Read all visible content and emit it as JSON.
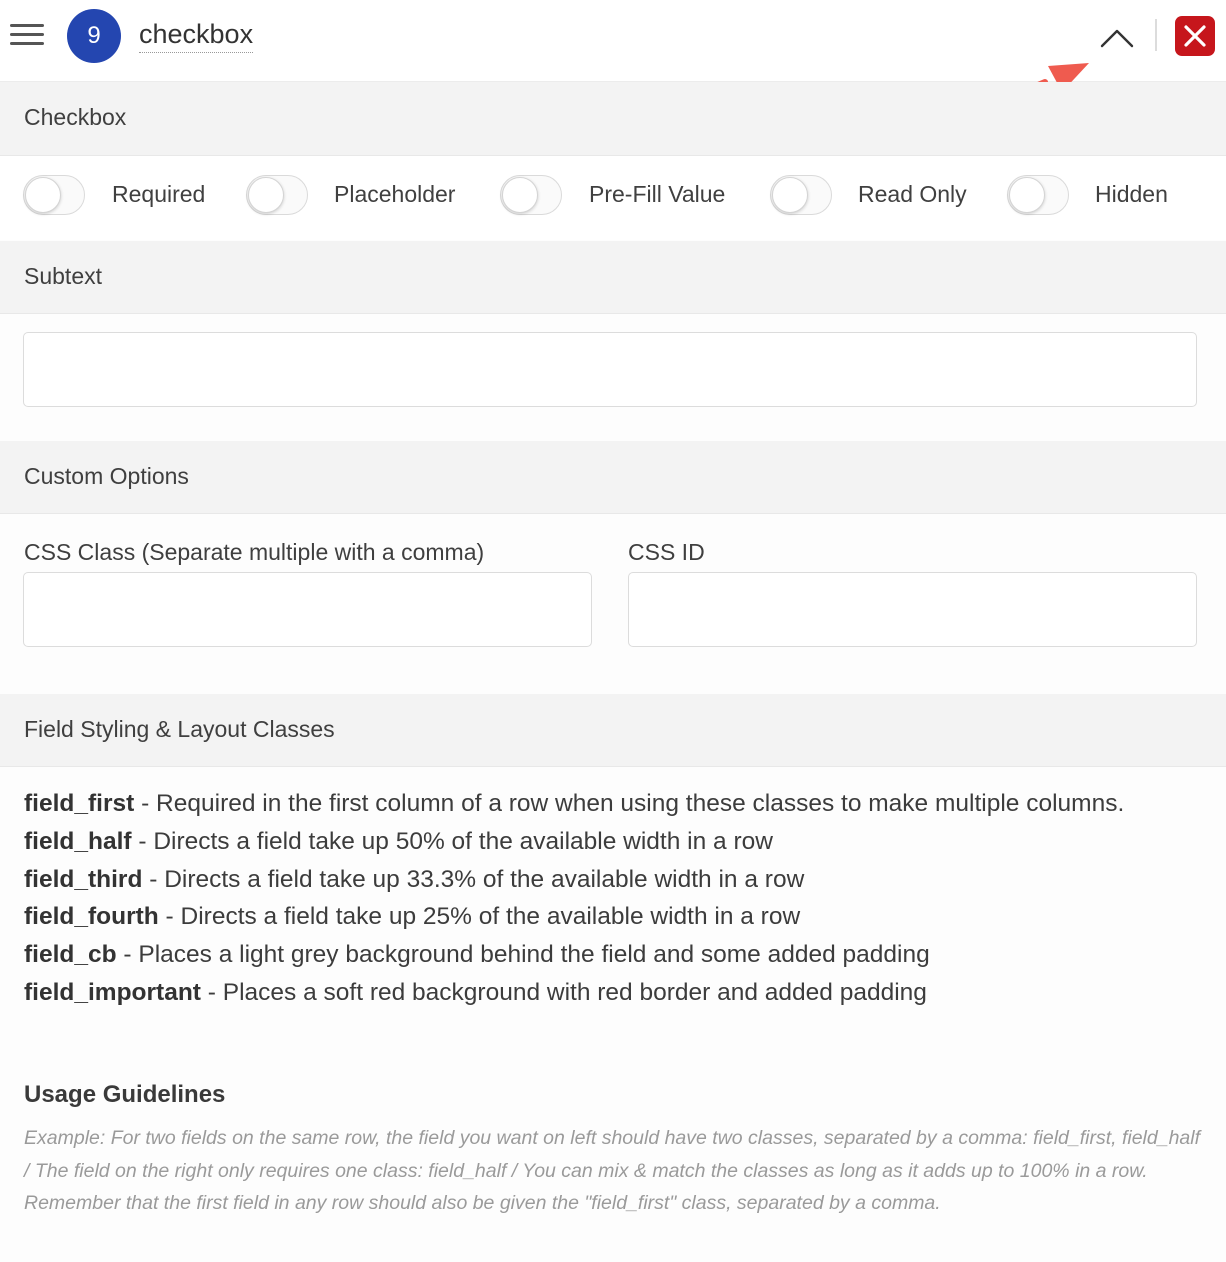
{
  "header": {
    "field_number": "9",
    "field_title": "checkbox",
    "icons": {
      "menu": "hamburger-menu-icon",
      "collapse": "chevron-up-icon",
      "close": "close-x-icon"
    },
    "colors": {
      "badge": "#2446b0",
      "close": "#c6161c",
      "annotation_arrow": "#ef5b4f"
    }
  },
  "sections": {
    "checkbox": "Checkbox",
    "subtext": "Subtext",
    "custom_options": "Custom Options",
    "styling": "Field Styling & Layout Classes"
  },
  "toggles": [
    {
      "label": "Required",
      "on": false
    },
    {
      "label": "Placeholder",
      "on": false
    },
    {
      "label": "Pre-Fill Value",
      "on": false
    },
    {
      "label": "Read Only",
      "on": false
    },
    {
      "label": "Hidden",
      "on": false
    }
  ],
  "subtext_input": {
    "value": "",
    "placeholder": ""
  },
  "custom_options": {
    "css_class_label": "CSS Class (Separate multiple with a comma)",
    "css_class_value": "",
    "css_id_label": "CSS ID",
    "css_id_value": ""
  },
  "styling_classes": [
    {
      "name": "field_first",
      "desc": " - Required in the first column of a row when using these classes to make multiple columns."
    },
    {
      "name": "field_half",
      "desc": " - Directs a field take up 50% of the available width in a row"
    },
    {
      "name": "field_third",
      "desc": " - Directs a field take up 33.3% of the available width in a row"
    },
    {
      "name": "field_fourth",
      "desc": " - Directs a field take up 25% of the available width in a row"
    },
    {
      "name": "field_cb",
      "desc": " - Places a light grey background behind the field and some added padding"
    },
    {
      "name": "field_important",
      "desc": " - Places a soft red background with red border and added padding"
    }
  ],
  "usage": {
    "title": "Usage Guidelines",
    "text": "Example: For two fields on the same row, the field you want on left should have two classes, separated by a comma: field_first, field_half / The field on the right only requires one class: field_half / You can mix & match the classes as long as it adds up to 100% in a row. Remember that the first field in any row should also be given the \"field_first\" class, separated by a comma."
  }
}
